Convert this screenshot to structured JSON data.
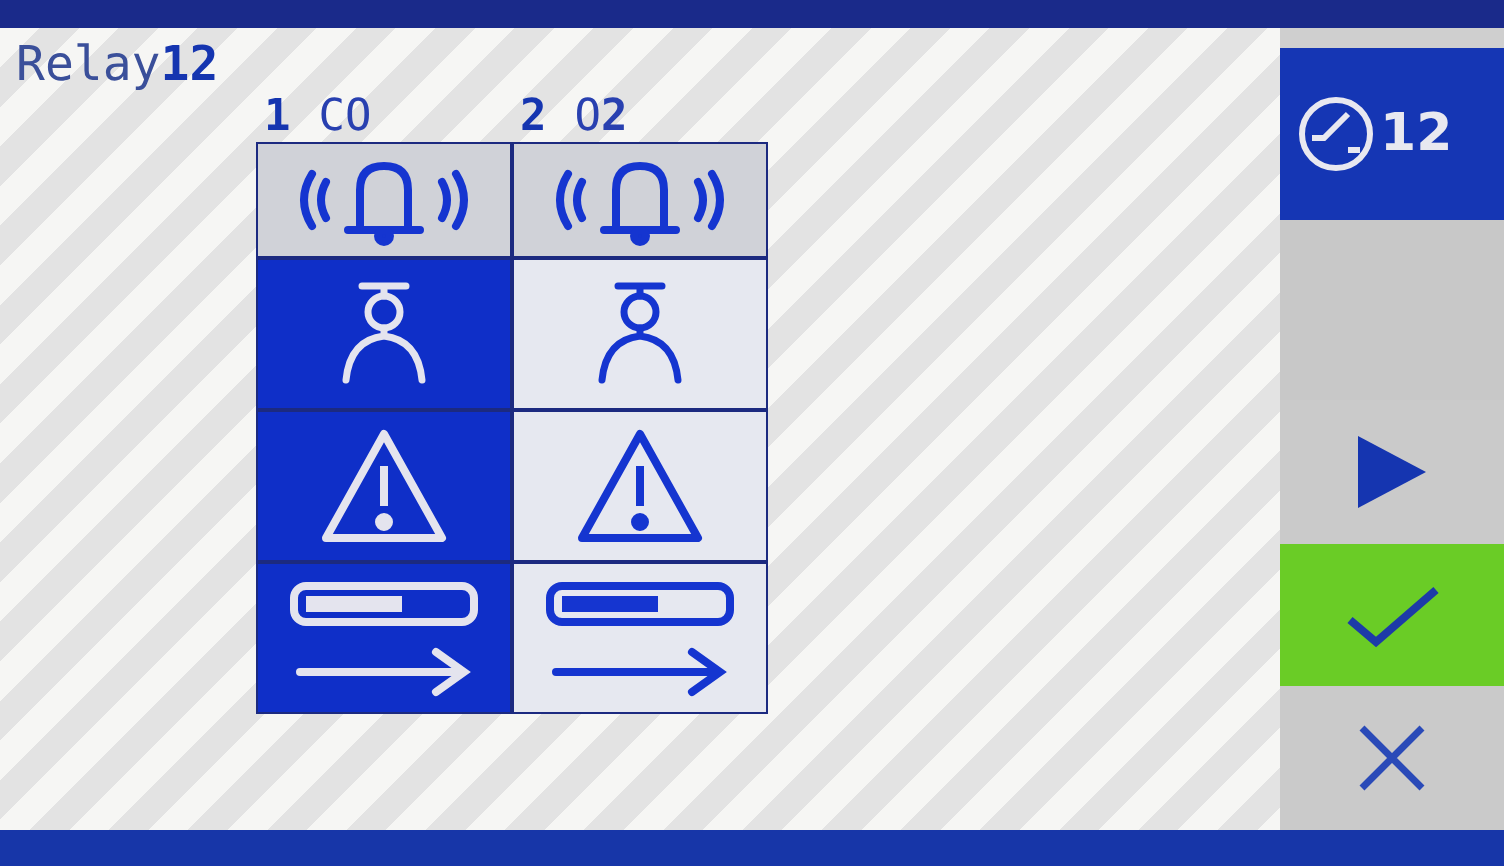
{
  "title": {
    "label": "Relay",
    "number": "12"
  },
  "channels": [
    {
      "number": "1",
      "name": "CO"
    },
    {
      "number": "2",
      "name": "O**2**"
    }
  ],
  "rows": [
    {
      "kind": "bell",
      "cells": [
        {
          "selected": false
        },
        {
          "selected": false
        }
      ]
    },
    {
      "kind": "person",
      "cells": [
        {
          "selected": true
        },
        {
          "selected": false
        }
      ]
    },
    {
      "kind": "warning",
      "cells": [
        {
          "selected": true
        },
        {
          "selected": false
        }
      ]
    },
    {
      "kind": "progress",
      "cells": [
        {
          "selected": true
        },
        {
          "selected": false
        }
      ]
    }
  ],
  "clock": {
    "value": "12"
  },
  "buttons": [
    {
      "kind": "next",
      "selected": false
    },
    {
      "kind": "confirm",
      "selected": true
    },
    {
      "kind": "cancel",
      "selected": false
    }
  ]
}
